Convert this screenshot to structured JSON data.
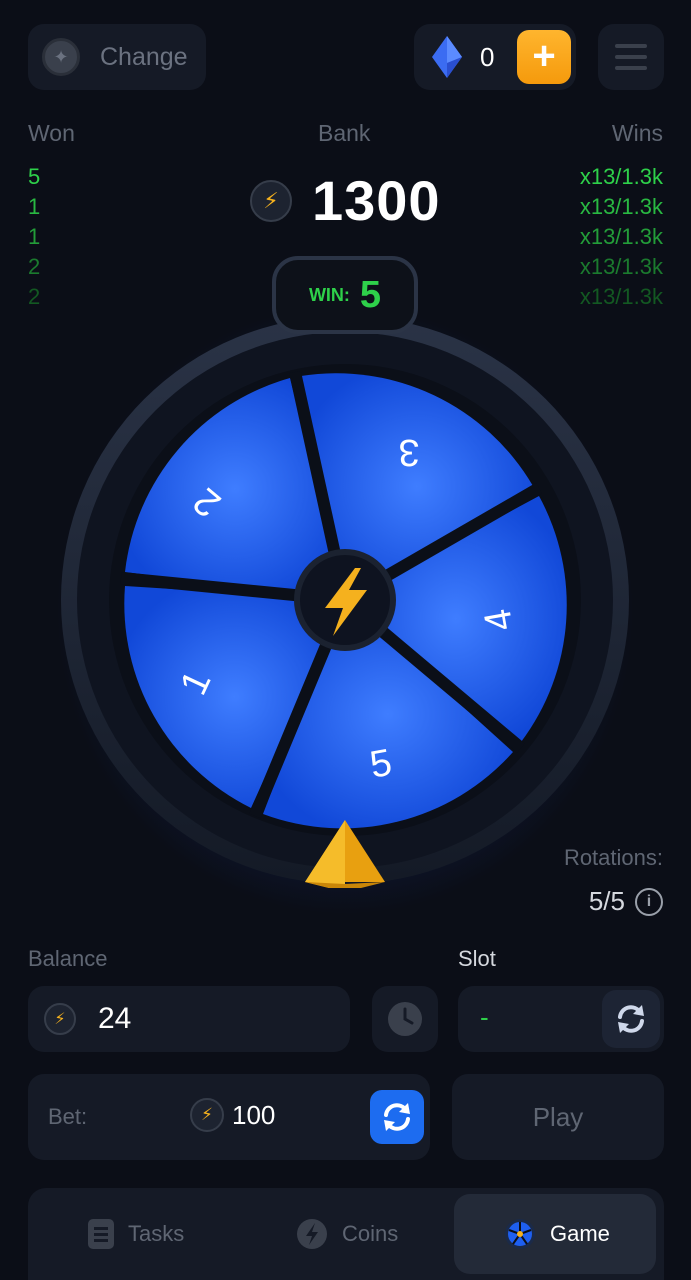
{
  "topbar": {
    "change_label": "Change",
    "gems_value": "0",
    "plus_label": "+"
  },
  "stats": {
    "won_label": "Won",
    "bank_label": "Bank",
    "wins_label": "Wins",
    "won_items": [
      "5",
      "1",
      "1",
      "2",
      "2"
    ],
    "wins_items": [
      "x13/1.3k",
      "x13/1.3k",
      "x13/1.3k",
      "x13/1.3k",
      "x13/1.3k"
    ],
    "bank_value": "1300"
  },
  "win_pill": {
    "label": "WIN:",
    "value": "5"
  },
  "wheel": {
    "segments": [
      "1",
      "2",
      "3",
      "4",
      "5"
    ]
  },
  "rotations": {
    "label": "Rotations:",
    "value": "5/5",
    "info_glyph": "i"
  },
  "balance": {
    "label": "Balance",
    "value": "24"
  },
  "slot": {
    "label": "Slot",
    "value": "-"
  },
  "bet": {
    "label": "Bet:",
    "value": "100"
  },
  "play_label": "Play",
  "nav": {
    "tasks": "Tasks",
    "coins": "Coins",
    "game": "Game"
  },
  "colors": {
    "accent_green": "#2ed14a",
    "wheel_blue": "#1e5ff0",
    "plus_orange": "#f5a31a",
    "background": "#0b0e17"
  },
  "icons": [
    "coin-change-icon",
    "gem-icon",
    "menu-icon",
    "bolt-icon",
    "clock-icon",
    "refresh-icon",
    "info-icon",
    "tasks-icon",
    "coins-icon",
    "game-icon",
    "pointer-icon"
  ]
}
